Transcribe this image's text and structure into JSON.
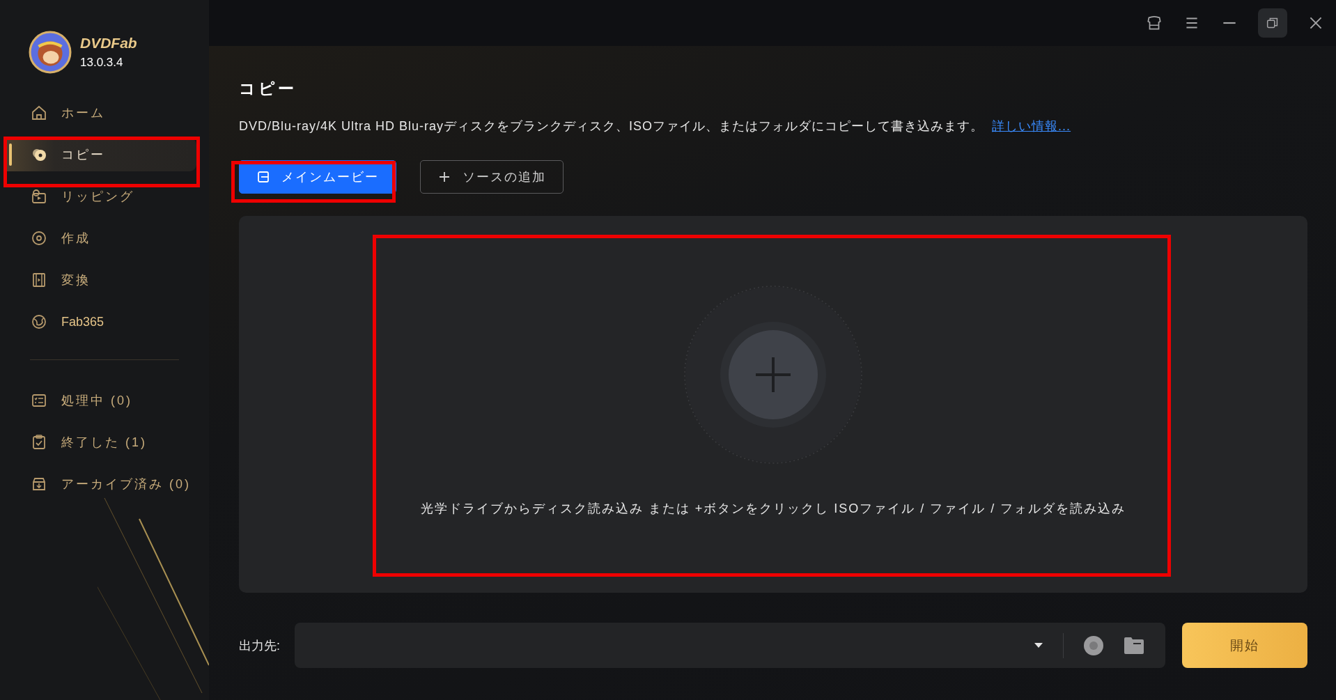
{
  "app": {
    "name": "DVDFab",
    "version": "13.0.3.4"
  },
  "sidebar": {
    "items": [
      {
        "kind": "home",
        "label": "ホーム",
        "selected": false
      },
      {
        "kind": "copy",
        "label": "コピー",
        "selected": true
      },
      {
        "kind": "ripper",
        "label": "リッピング",
        "selected": false
      },
      {
        "kind": "creator",
        "label": "作成",
        "selected": false
      },
      {
        "kind": "converter",
        "label": "変換",
        "selected": false
      },
      {
        "kind": "fab365",
        "label": "Fab365",
        "selected": false
      }
    ],
    "tasks": [
      {
        "kind": "processing",
        "label": "処理中 (0)"
      },
      {
        "kind": "finished",
        "label": "終了した (1)"
      },
      {
        "kind": "archived",
        "label": "アーカイブ済み (0)"
      }
    ]
  },
  "page": {
    "title": "コピー",
    "description": "DVD/Blu-ray/4K Ultra HD Blu-rayディスクをブランクディスク、ISOファイル、またはフォルダにコピーして書き込みます。",
    "link": "詳しい情報..."
  },
  "mode_buttons": [
    {
      "kind": "mode",
      "label": "メインムービー",
      "selected": true
    },
    {
      "kind": "add",
      "label": "ソースの追加",
      "selected": false
    }
  ],
  "dropzone": {
    "hint": "光学ドライブからディスク読み込み または +ボタンをクリックし ISOファイル / ファイル / フォルダを読み込み"
  },
  "output": {
    "label": "出力先:",
    "start_button": "開始"
  }
}
